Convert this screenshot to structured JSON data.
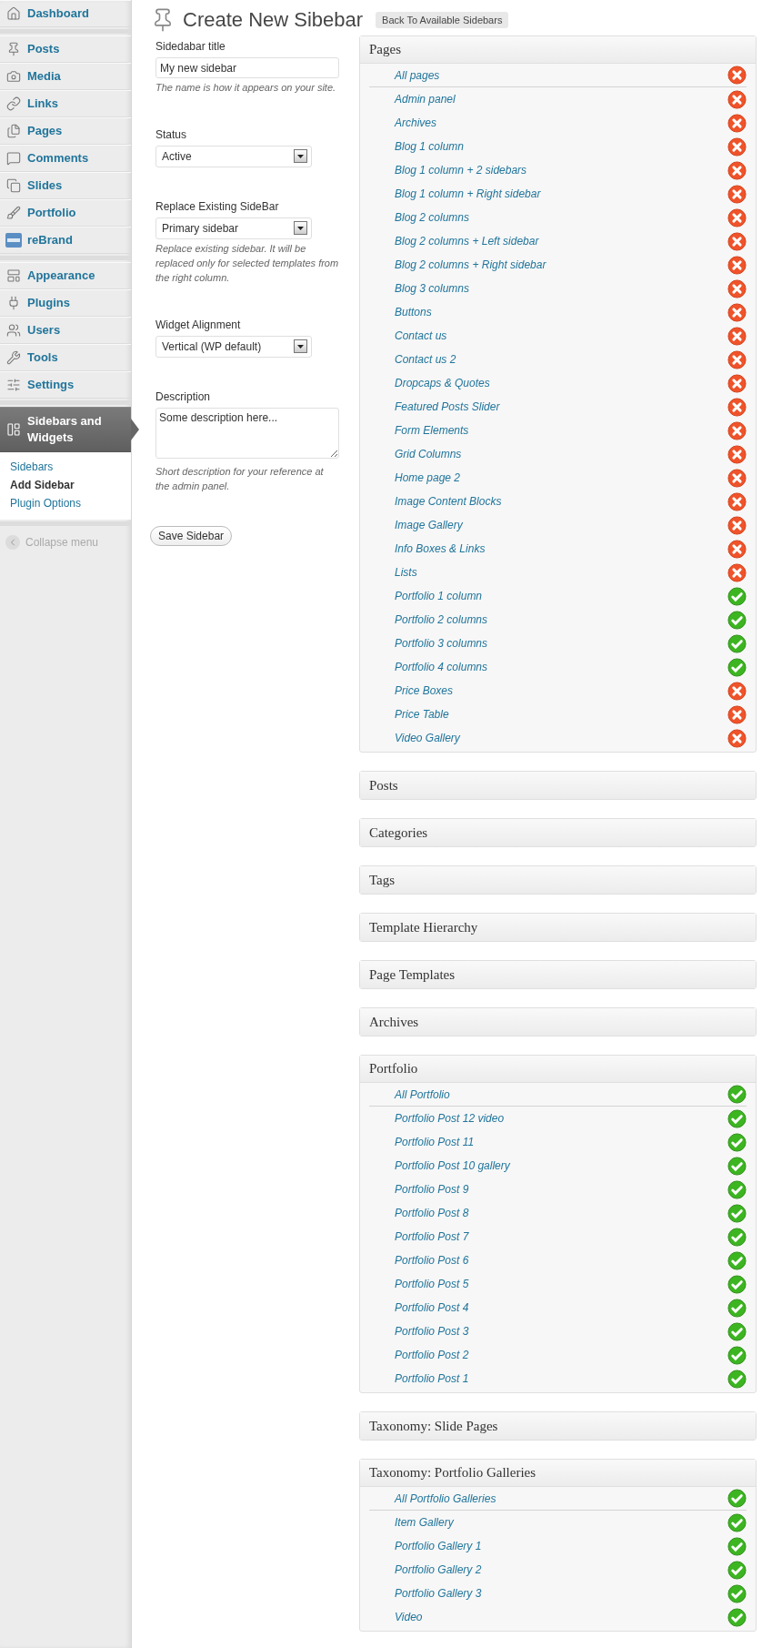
{
  "admin_menu": {
    "groups": [
      {
        "items": [
          {
            "label": "Dashboard",
            "selected": false
          }
        ]
      },
      {
        "items": [
          {
            "label": "Posts",
            "selected": false
          },
          {
            "label": "Media",
            "selected": false
          },
          {
            "label": "Links",
            "selected": false
          },
          {
            "label": "Pages",
            "selected": false
          },
          {
            "label": "Comments",
            "selected": false
          },
          {
            "label": "Slides",
            "selected": false
          },
          {
            "label": "Portfolio",
            "selected": false
          },
          {
            "label": "reBrand",
            "selected": false
          }
        ]
      },
      {
        "items": [
          {
            "label": "Appearance",
            "selected": false
          },
          {
            "label": "Plugins",
            "selected": false
          },
          {
            "label": "Users",
            "selected": false
          },
          {
            "label": "Tools",
            "selected": false
          },
          {
            "label": "Settings",
            "selected": false
          }
        ]
      },
      {
        "items": [
          {
            "label": "Sidebars and Widgets",
            "selected": true,
            "submenu": [
              {
                "label": "Sidebars",
                "selected": false
              },
              {
                "label": "Add Sidebar",
                "selected": true
              },
              {
                "label": "Plugin Options",
                "selected": false
              }
            ]
          }
        ]
      }
    ],
    "collapse": {
      "label": "Collapse menu"
    }
  },
  "page_title": "Create New Sibebar",
  "back_button": "Back To Available Sidebars",
  "form": {
    "fields": [
      {
        "kind": "text",
        "label": "Sidedabar title",
        "value": "My new sidebar",
        "help": "The name is how it appears on your site."
      },
      {
        "kind": "select",
        "label": "Status",
        "value": "Active"
      },
      {
        "kind": "select",
        "label": "Replace Existing SideBar",
        "value": "Primary sidebar",
        "help": "Replace existing sidebar. It will be replaced only for selected templates from the right column."
      },
      {
        "kind": "select",
        "label": "Widget Alignment",
        "value": "Vertical (WP default)"
      },
      {
        "kind": "textarea",
        "label": "Description",
        "value": "Some description here...",
        "help": "Short description for your reference at the admin panel."
      }
    ],
    "submit": "Save Sidebar"
  },
  "panels": [
    {
      "title": "Pages",
      "expanded": true,
      "items": [
        {
          "kind": "all",
          "label": "All pages",
          "enabled": false
        },
        {
          "kind": "item",
          "label": "Admin panel",
          "enabled": false
        },
        {
          "kind": "item",
          "label": "Archives",
          "enabled": false
        },
        {
          "kind": "item",
          "label": "Blog 1 column",
          "enabled": false
        },
        {
          "kind": "item",
          "label": "Blog 1 column + 2 sidebars",
          "enabled": false
        },
        {
          "kind": "item",
          "label": "Blog 1 column + Right sidebar",
          "enabled": false
        },
        {
          "kind": "item",
          "label": "Blog 2 columns",
          "enabled": false
        },
        {
          "kind": "item",
          "label": "Blog 2 columns + Left sidebar",
          "enabled": false
        },
        {
          "kind": "item",
          "label": "Blog 2 columns + Right sidebar",
          "enabled": false
        },
        {
          "kind": "item",
          "label": "Blog 3 columns",
          "enabled": false
        },
        {
          "kind": "item",
          "label": "Buttons",
          "enabled": false
        },
        {
          "kind": "item",
          "label": "Contact us",
          "enabled": false
        },
        {
          "kind": "item",
          "label": "Contact us 2",
          "enabled": false
        },
        {
          "kind": "item",
          "label": "Dropcaps & Quotes",
          "enabled": false
        },
        {
          "kind": "item",
          "label": "Featured Posts Slider",
          "enabled": false
        },
        {
          "kind": "item",
          "label": "Form Elements",
          "enabled": false
        },
        {
          "kind": "item",
          "label": "Grid Columns",
          "enabled": false
        },
        {
          "kind": "item",
          "label": "Home page 2",
          "enabled": false
        },
        {
          "kind": "item",
          "label": "Image Content Blocks",
          "enabled": false
        },
        {
          "kind": "item",
          "label": "Image Gallery",
          "enabled": false
        },
        {
          "kind": "item",
          "label": "Info Boxes & Links",
          "enabled": false
        },
        {
          "kind": "item",
          "label": "Lists",
          "enabled": false
        },
        {
          "kind": "item",
          "label": "Portfolio 1 column",
          "enabled": true
        },
        {
          "kind": "item",
          "label": "Portfolio 2 columns",
          "enabled": true
        },
        {
          "kind": "item",
          "label": "Portfolio 3 columns",
          "enabled": true
        },
        {
          "kind": "item",
          "label": "Portfolio 4 columns",
          "enabled": true
        },
        {
          "kind": "item",
          "label": "Price Boxes",
          "enabled": false
        },
        {
          "kind": "item",
          "label": "Price Table",
          "enabled": false
        },
        {
          "kind": "item",
          "label": "Video Gallery",
          "enabled": false
        }
      ]
    },
    {
      "title": "Posts",
      "expanded": false
    },
    {
      "title": "Categories",
      "expanded": false
    },
    {
      "title": "Tags",
      "expanded": false
    },
    {
      "title": "Template Hierarchy",
      "expanded": false
    },
    {
      "title": "Page Templates",
      "expanded": false
    },
    {
      "title": "Archives",
      "expanded": false
    },
    {
      "title": "Portfolio",
      "expanded": true,
      "items": [
        {
          "kind": "all",
          "label": "All Portfolio",
          "enabled": true
        },
        {
          "kind": "item",
          "label": "Portfolio Post 12 video",
          "enabled": true
        },
        {
          "kind": "item",
          "label": "Portfolio Post 11",
          "enabled": true
        },
        {
          "kind": "item",
          "label": "Portfolio Post 10 gallery",
          "enabled": true
        },
        {
          "kind": "item",
          "label": "Portfolio Post 9",
          "enabled": true
        },
        {
          "kind": "item",
          "label": "Portfolio Post 8",
          "enabled": true
        },
        {
          "kind": "item",
          "label": "Portfolio Post 7",
          "enabled": true
        },
        {
          "kind": "item",
          "label": "Portfolio Post 6",
          "enabled": true
        },
        {
          "kind": "item",
          "label": "Portfolio Post 5",
          "enabled": true
        },
        {
          "kind": "item",
          "label": "Portfolio Post 4",
          "enabled": true
        },
        {
          "kind": "item",
          "label": "Portfolio Post 3",
          "enabled": true
        },
        {
          "kind": "item",
          "label": "Portfolio Post 2",
          "enabled": true
        },
        {
          "kind": "item",
          "label": "Portfolio Post 1",
          "enabled": true
        }
      ]
    },
    {
      "title": "Taxonomy: Slide Pages",
      "expanded": false
    },
    {
      "title": "Taxonomy: Portfolio Galleries",
      "expanded": true,
      "items": [
        {
          "kind": "all",
          "label": "All Portfolio Galleries",
          "enabled": true
        },
        {
          "kind": "item",
          "label": "Item Gallery",
          "enabled": true
        },
        {
          "kind": "item",
          "label": "Portfolio Gallery 1",
          "enabled": true
        },
        {
          "kind": "item",
          "label": "Portfolio Gallery 2",
          "enabled": true
        },
        {
          "kind": "item",
          "label": "Portfolio Gallery 3",
          "enabled": true
        },
        {
          "kind": "item",
          "label": "Video",
          "enabled": true
        }
      ]
    }
  ]
}
